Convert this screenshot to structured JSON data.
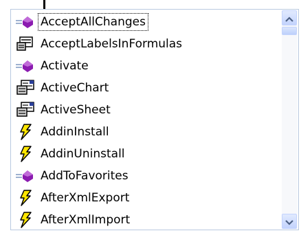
{
  "autocomplete": {
    "items": [
      {
        "label": "AcceptAllChanges",
        "icon": "method-icon",
        "selected": true
      },
      {
        "label": "AcceptLabelsInFormulas",
        "icon": "property-icon"
      },
      {
        "label": "Activate",
        "icon": "method-icon"
      },
      {
        "label": "ActiveChart",
        "icon": "property-icon"
      },
      {
        "label": "ActiveSheet",
        "icon": "property-icon"
      },
      {
        "label": "AddinInstall",
        "icon": "event-icon"
      },
      {
        "label": "AddinUninstall",
        "icon": "event-icon"
      },
      {
        "label": "AddToFavorites",
        "icon": "method-icon"
      },
      {
        "label": "AfterXmlExport",
        "icon": "event-icon"
      },
      {
        "label": "AfterXmlImport",
        "icon": "event-icon"
      }
    ]
  },
  "colors": {
    "method_purple": "#8b1bb0",
    "event_yellow": "#ffe600",
    "scroll_blue": "#c3d3fd",
    "border_blue": "#b9c9e0"
  }
}
